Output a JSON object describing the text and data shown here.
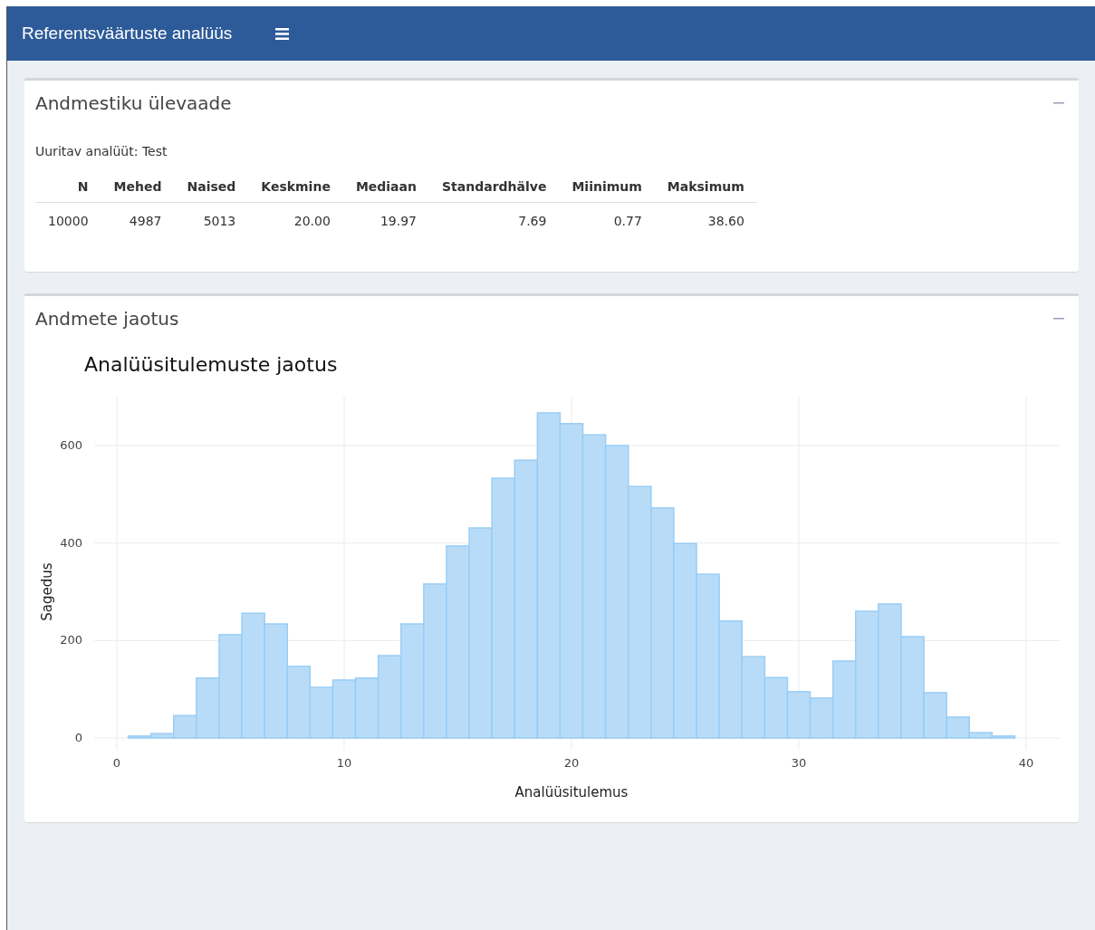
{
  "header": {
    "title": "Referentsväärtuste analüüs"
  },
  "overview": {
    "title": "Andmestiku ülevaade",
    "analyte_label": "Uuritav analüüt: Test",
    "table": {
      "columns": [
        "N",
        "Mehed",
        "Naised",
        "Keskmine",
        "Mediaan",
        "Standardhälve",
        "Miinimum",
        "Maksimum"
      ],
      "rows": [
        [
          "10000",
          "4987",
          "5013",
          "20.00",
          "19.97",
          "7.69",
          "0.77",
          "38.60"
        ]
      ]
    }
  },
  "distribution": {
    "title": "Andmete jaotus",
    "chart_data": {
      "type": "bar",
      "title": "Analüüsitulemuste jaotus",
      "xlabel": "Analüüsitulemus",
      "ylabel": "Sagedus",
      "x": [
        1,
        2,
        3,
        4,
        5,
        6,
        7,
        8,
        9,
        10,
        11,
        12,
        13,
        14,
        15,
        16,
        17,
        18,
        19,
        20,
        21,
        22,
        23,
        24,
        25,
        26,
        27,
        28,
        29,
        30,
        31,
        32,
        33,
        34,
        35,
        36,
        37,
        38,
        39
      ],
      "values": [
        4,
        9,
        46,
        123,
        212,
        256,
        234,
        147,
        104,
        119,
        123,
        169,
        234,
        316,
        394,
        431,
        533,
        570,
        667,
        645,
        622,
        600,
        516,
        472,
        399,
        336,
        240,
        167,
        124,
        95,
        82,
        158,
        260,
        275,
        208,
        93,
        43,
        11,
        4
      ],
      "xlim": [
        -1,
        41.5
      ],
      "ylim": [
        -25,
        700
      ],
      "xticks": [
        0,
        10,
        20,
        30,
        40
      ],
      "yticks": [
        0,
        200,
        400,
        600
      ],
      "grid": true
    }
  }
}
